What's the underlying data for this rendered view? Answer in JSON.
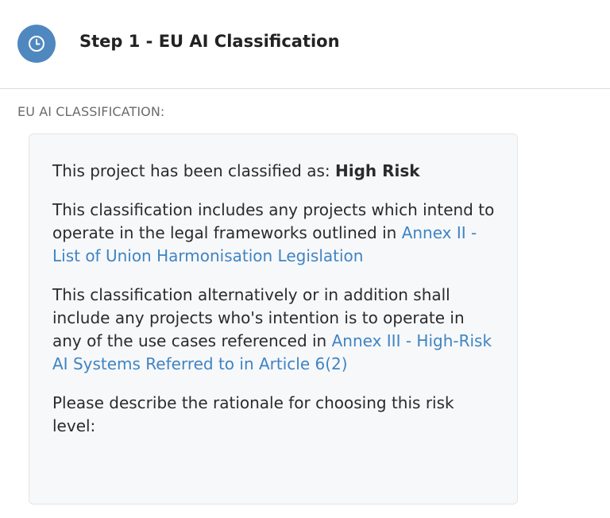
{
  "header": {
    "icon": "clock-icon",
    "title": "Step 1 - EU AI Classification"
  },
  "section": {
    "label": "EU AI CLASSIFICATION:"
  },
  "card": {
    "classified_prefix": "This project has been classified as: ",
    "classification": "High Risk",
    "para2_text": "This classification includes any projects which intend to operate in the legal frameworks outlined in ",
    "para2_link": "Annex II - List of Union Harmonisation Legislation",
    "para3_text": "This classification alternatively or in addition shall include any projects who's intention is to operate in any of the use cases referenced in ",
    "para3_link": "Annex III - High-Risk AI Systems Referred to in Article 6(2)",
    "prompt": "Please describe the rationale for choosing this risk level:"
  },
  "colors": {
    "accent": "#4f88bf",
    "link": "#3f84c2",
    "card_bg": "#f7f8fa"
  }
}
